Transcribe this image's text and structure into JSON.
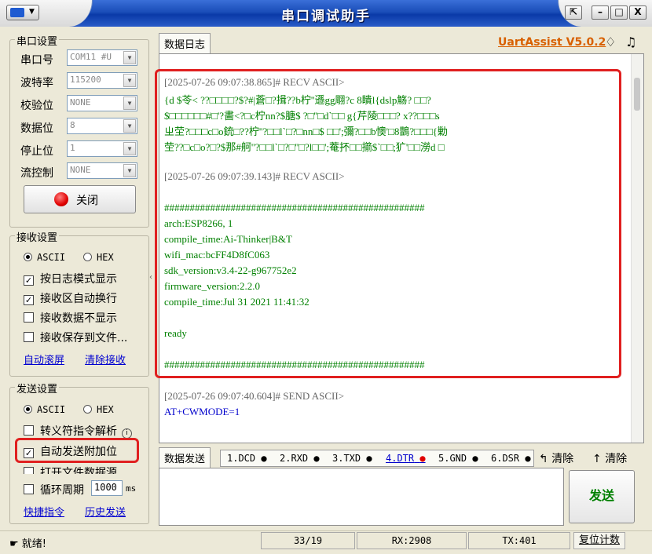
{
  "window": {
    "title": "串口调试助手",
    "controls": {
      "restore": "⇱",
      "minimize": "-",
      "close": "□",
      "x": "X"
    }
  },
  "serial_settings": {
    "legend": "串口设置",
    "port": {
      "label": "串口号",
      "value": "COM11 #U"
    },
    "baud": {
      "label": "波特率",
      "value": "115200"
    },
    "parity": {
      "label": "校验位",
      "value": "NONE"
    },
    "databits": {
      "label": "数据位",
      "value": "8"
    },
    "stopbits": {
      "label": "停止位",
      "value": "1"
    },
    "flow": {
      "label": "流控制",
      "value": "NONE"
    },
    "close_button": "关闭"
  },
  "receive_settings": {
    "legend": "接收设置",
    "ascii": "ASCII",
    "hex": "HEX",
    "opt1": "按日志模式显示",
    "opt2": "接收区自动换行",
    "opt3": "接收数据不显示",
    "opt4": "接收保存到文件...",
    "link_autoscroll": "自动滚屏",
    "link_clear": "清除接收"
  },
  "send_settings": {
    "legend": "发送设置",
    "ascii": "ASCII",
    "hex": "HEX",
    "opt1": "转义符指令解析",
    "opt2": "自动发送附加位",
    "opt3": "打开文件数据源...",
    "opt4": "循环周期",
    "period": "1000",
    "period_unit": "ms",
    "link_shortcut": "快捷指令",
    "link_history": "历史发送"
  },
  "log_panel": {
    "tab": "数据日志",
    "brand": "UartAssist V5.0.2",
    "entries": [
      {
        "text": "[2025-07-26 09:07:38.865]# RECV ASCII>",
        "cls": "gray"
      },
      {
        "text": "{d $苓< ??□□□□?$?#|蒼□?揖??b柠''遜gg翢?c  8瞶l{dslp觞? □□?",
        "cls": "green"
      },
      {
        "text": "$□□□□□□#□'?畵<?□c柠nn?$膅$  ?□''□d`□□ g{芹陵□□□?  x??□□□s",
        "cls": "green"
      },
      {
        "text": "ㄓ茔?□□□c□o銃□??柠''?□□l`□?□nn□$  □□';彌?□□b懊'□8鵲?□□□{勦",
        "cls": "green"
      },
      {
        "text": "茔??□c□o?□?$那#舸''?□□l`□?□''□?l□□';菴抔□□擶$`□□;犷'□□澇d □",
        "cls": "green"
      },
      {
        "text": "[2025-07-26 09:07:39.143]# RECV ASCII>",
        "cls": "gray"
      },
      {
        "text": "###################################################",
        "cls": "green"
      },
      {
        "text": "arch:ESP8266, 1",
        "cls": "green"
      },
      {
        "text": "compile_time:Ai-Thinker|B&T",
        "cls": "green"
      },
      {
        "text": "wifi_mac:bcFF4D8fC063",
        "cls": "green"
      },
      {
        "text": "sdk_version:v3.4-22-g967752e2",
        "cls": "green"
      },
      {
        "text": "firmware_version:2.2.0",
        "cls": "green"
      },
      {
        "text": "compile_time:Jul 31 2021 11:41:32",
        "cls": "green"
      },
      {
        "text": "ready",
        "cls": "green"
      },
      {
        "text": "###################################################",
        "cls": "green"
      },
      {
        "text": "[2025-07-26 09:07:40.604]# SEND ASCII>",
        "cls": "gray"
      },
      {
        "text": "AT+CWMODE=1",
        "cls": "blue"
      }
    ]
  },
  "send_panel": {
    "tab": "数据发送",
    "pins": [
      "1.DCD",
      "2.RXD",
      "3.TXD",
      "4.DTR",
      "5.GND",
      "6.DSR"
    ],
    "clear1": "清除",
    "clear2": "清除",
    "send_button": "发送"
  },
  "statusbar": {
    "ready": "就绪!",
    "counter": "33/19",
    "rx": "RX:2908",
    "tx": "TX:401",
    "reset": "复位计数"
  }
}
